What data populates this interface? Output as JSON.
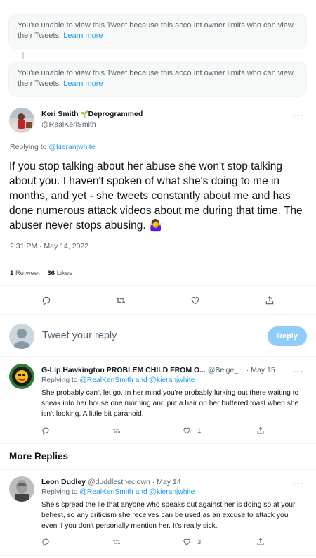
{
  "notices": [
    {
      "text": "You're unable to view this Tweet because this account owner limits who can view their Tweets.",
      "link": "Learn more"
    },
    {
      "text": "You're unable to view this Tweet because this account owner limits who can view their Tweets.",
      "link": "Learn more"
    }
  ],
  "main_tweet": {
    "author_name": "Keri Smith",
    "author_badge": "🌱",
    "author_suffix": "Deprogrammed",
    "handle": "@RealKeriSmith",
    "replying_prefix": "Replying to",
    "replying_to": "@kieranjwhite",
    "text": "If you stop talking about her abuse she won't stop talking about you. I haven't spoken of what she's doing to me in months, and yet - she tweets constantly about me and has done numerous attack videos about me during that time. The abuser never stops abusing. 🤷‍♀️",
    "timestamp": "2:31 PM · May 14, 2022",
    "retweets_count": "1",
    "retweets_label": "Retweet",
    "likes_count": "36",
    "likes_label": "Likes",
    "more": "···"
  },
  "compose": {
    "placeholder": "Tweet your reply",
    "button": "Reply"
  },
  "replies": [
    {
      "name": "G-Lip Hawkington PROBLEM CHILD FROM O...",
      "handle": "@Beige_...",
      "date": "· May 15",
      "replying_prefix": "Replying to",
      "replying_to": "@RealKeriSmith and @kieranjwhite",
      "text": "She probably can't let go. In her mind you're probably lurking out there waiting to sneak into her house one morning and put a hair on her buttered toast when she isn't looking. A little bit paranoid.",
      "likes": "1",
      "more": "···"
    }
  ],
  "more_replies_title": "More Replies",
  "more_replies": [
    {
      "name": "Leon Dudley",
      "handle": "@duddlestheclown",
      "date": "· May 14",
      "replying_prefix": "Replying to",
      "replying_to": "@RealKeriSmith and @kieranjwhite",
      "text": "She's spread the lie that anyone who speaks out against her is doing so at your behest, so any criticism she receives can be used as an excuse to attack you even if you don't personally mention her. It's really sick.",
      "likes": "3",
      "more": "···"
    }
  ]
}
